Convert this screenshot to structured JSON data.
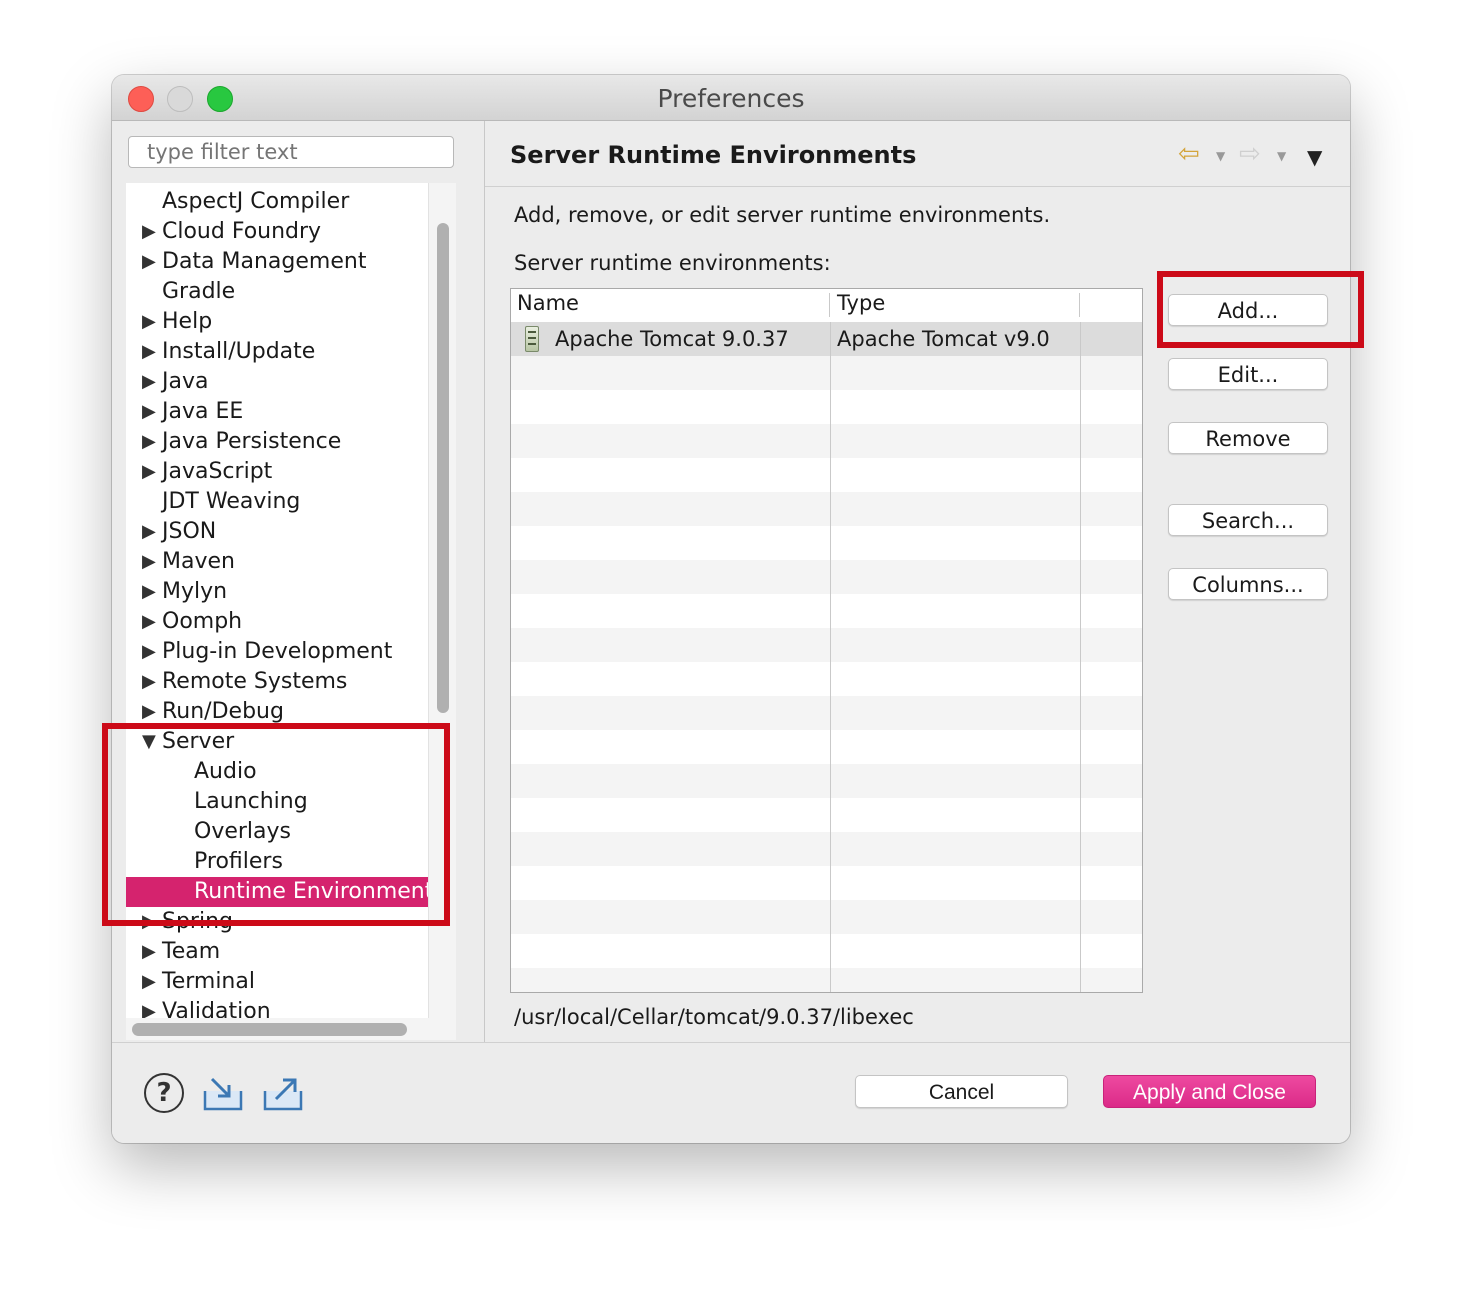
{
  "window": {
    "title": "Preferences"
  },
  "filter": {
    "placeholder": "type filter text"
  },
  "tree": {
    "items": [
      {
        "label": "AspectJ Compiler",
        "expander": "none"
      },
      {
        "label": "Cloud Foundry",
        "expander": "collapsed"
      },
      {
        "label": "Data Management",
        "expander": "collapsed"
      },
      {
        "label": "Gradle",
        "expander": "none"
      },
      {
        "label": "Help",
        "expander": "collapsed"
      },
      {
        "label": "Install/Update",
        "expander": "collapsed"
      },
      {
        "label": "Java",
        "expander": "collapsed"
      },
      {
        "label": "Java EE",
        "expander": "collapsed"
      },
      {
        "label": "Java Persistence",
        "expander": "collapsed"
      },
      {
        "label": "JavaScript",
        "expander": "collapsed"
      },
      {
        "label": "JDT Weaving",
        "expander": "none"
      },
      {
        "label": "JSON",
        "expander": "collapsed"
      },
      {
        "label": "Maven",
        "expander": "collapsed"
      },
      {
        "label": "Mylyn",
        "expander": "collapsed"
      },
      {
        "label": "Oomph",
        "expander": "collapsed"
      },
      {
        "label": "Plug-in Development",
        "expander": "collapsed"
      },
      {
        "label": "Remote Systems",
        "expander": "collapsed"
      },
      {
        "label": "Run/Debug",
        "expander": "collapsed"
      },
      {
        "label": "Server",
        "expander": "expanded"
      },
      {
        "label": "Audio",
        "expander": "child"
      },
      {
        "label": "Launching",
        "expander": "child"
      },
      {
        "label": "Overlays",
        "expander": "child"
      },
      {
        "label": "Profilers",
        "expander": "child"
      },
      {
        "label": "Runtime Environments",
        "expander": "child",
        "selected": true
      },
      {
        "label": "Spring",
        "expander": "collapsed"
      },
      {
        "label": "Team",
        "expander": "collapsed"
      },
      {
        "label": "Terminal",
        "expander": "collapsed"
      },
      {
        "label": "Validation",
        "expander": "collapsed"
      }
    ]
  },
  "page": {
    "title": "Server Runtime Environments",
    "description": "Add, remove, or edit server runtime environments.",
    "table_label": "Server runtime environments:",
    "columns": {
      "name": "Name",
      "type": "Type"
    },
    "rows": [
      {
        "name": "Apache Tomcat 9.0.37",
        "type": "Apache Tomcat v9.0"
      }
    ],
    "location": "/usr/local/Cellar/tomcat/9.0.37/libexec"
  },
  "buttons": {
    "add": "Add...",
    "edit": "Edit...",
    "remove": "Remove",
    "search": "Search...",
    "columns": "Columns..."
  },
  "footer": {
    "help_glyph": "?",
    "cancel": "Cancel",
    "apply_close": "Apply and Close"
  },
  "icons": {
    "back": "back-arrow-icon",
    "forward": "forward-arrow-icon",
    "menu": "view-menu-icon",
    "server": "server-icon",
    "help": "help-icon",
    "import": "import-icon",
    "export": "export-icon"
  },
  "colors": {
    "selection": "#d5236e",
    "primary_button": "#e13a93",
    "annotation": "#cc0a18",
    "back_arrow": "#d3a43a"
  }
}
